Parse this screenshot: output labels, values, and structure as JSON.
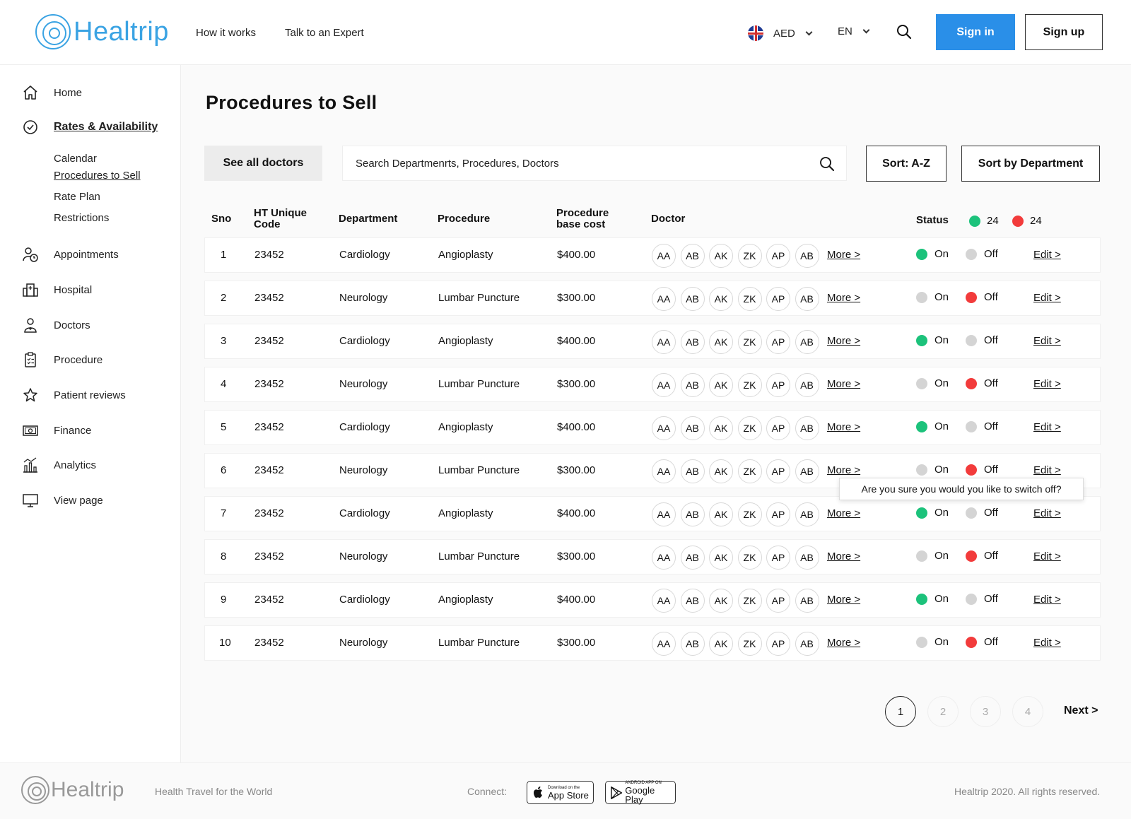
{
  "header": {
    "logo": "Healtrip",
    "nav": [
      "How it works",
      "Talk to an Expert"
    ],
    "currency": "AED",
    "language": "EN",
    "signin": "Sign in",
    "signup": "Sign up",
    "accent": "#2a8fe8"
  },
  "sidebar": {
    "items": [
      {
        "label": "Home",
        "icon": "home-icon"
      },
      {
        "label": "Rates & Availability",
        "icon": "check-circle-icon",
        "active": true
      },
      {
        "label": "Appointments",
        "icon": "appointments-icon"
      },
      {
        "label": "Hospital",
        "icon": "hospital-icon"
      },
      {
        "label": "Doctors",
        "icon": "doctor-icon"
      },
      {
        "label": "Procedure",
        "icon": "clipboard-icon"
      },
      {
        "label": "Patient reviews",
        "icon": "star-icon"
      },
      {
        "label": "Finance",
        "icon": "money-icon"
      },
      {
        "label": "Analytics",
        "icon": "analytics-icon"
      },
      {
        "label": "View page",
        "icon": "monitor-icon"
      }
    ],
    "subitems": [
      "Calendar",
      "Procedures to Sell",
      "Rate Plan",
      "Restrictions"
    ]
  },
  "main": {
    "title": "Procedures to Sell",
    "see_all_doctors": "See all doctors",
    "search_placeholder": "Search Departmenrts, Procedures, Doctors",
    "sort_az": "Sort: A-Z",
    "sort_dept": "Sort by Department"
  },
  "table": {
    "headers": {
      "sno": "Sno",
      "code": "HT Unique Code",
      "department": "Department",
      "procedure": "Procedure",
      "cost": "Procedure base cost",
      "doctor": "Doctor",
      "status": "Status"
    },
    "status_on_count": "24",
    "status_off_count": "24",
    "doctor_initials": [
      "AA",
      "AB",
      "AK",
      "ZK",
      "AP",
      "AB"
    ],
    "more_label": "More >",
    "on_label": "On",
    "off_label": "Off",
    "edit_label": "Edit >",
    "rows": [
      {
        "sno": "1",
        "code": "23452",
        "department": "Cardiology",
        "procedure": "Angioplasty",
        "cost": "$400.00",
        "status": "on"
      },
      {
        "sno": "2",
        "code": "23452",
        "department": "Neurology",
        "procedure": "Lumbar Puncture",
        "cost": "$300.00",
        "status": "off"
      },
      {
        "sno": "3",
        "code": "23452",
        "department": "Cardiology",
        "procedure": "Angioplasty",
        "cost": "$400.00",
        "status": "on"
      },
      {
        "sno": "4",
        "code": "23452",
        "department": "Neurology",
        "procedure": "Lumbar Puncture",
        "cost": "$300.00",
        "status": "off"
      },
      {
        "sno": "5",
        "code": "23452",
        "department": "Cardiology",
        "procedure": "Angioplasty",
        "cost": "$400.00",
        "status": "on"
      },
      {
        "sno": "6",
        "code": "23452",
        "department": "Neurology",
        "procedure": "Lumbar Puncture",
        "cost": "$300.00",
        "status": "off"
      },
      {
        "sno": "7",
        "code": "23452",
        "department": "Cardiology",
        "procedure": "Angioplasty",
        "cost": "$400.00",
        "status": "on"
      },
      {
        "sno": "8",
        "code": "23452",
        "department": "Neurology",
        "procedure": "Lumbar Puncture",
        "cost": "$300.00",
        "status": "off"
      },
      {
        "sno": "9",
        "code": "23452",
        "department": "Cardiology",
        "procedure": "Angioplasty",
        "cost": "$400.00",
        "status": "on"
      },
      {
        "sno": "10",
        "code": "23452",
        "department": "Neurology",
        "procedure": "Lumbar Puncture",
        "cost": "$300.00",
        "status": "off"
      }
    ],
    "tooltip": "Are you sure you would you like to switch off?",
    "colors": {
      "on": "#1cc27b",
      "off": "#f23b3b",
      "inactive": "#d4d4d4"
    }
  },
  "pagination": {
    "pages": [
      "1",
      "2",
      "3",
      "4"
    ],
    "current": "1",
    "next": "Next >"
  },
  "footer": {
    "logo": "Healtrip",
    "tagline": "Health Travel for the World",
    "connect": "Connect:",
    "appstore_small": "Download on the",
    "appstore_big": "App Store",
    "googleplay_small": "ANDROID APP ON",
    "googleplay_big": "Google Play",
    "copyright": "Healtrip 2020. All rights reserved."
  }
}
